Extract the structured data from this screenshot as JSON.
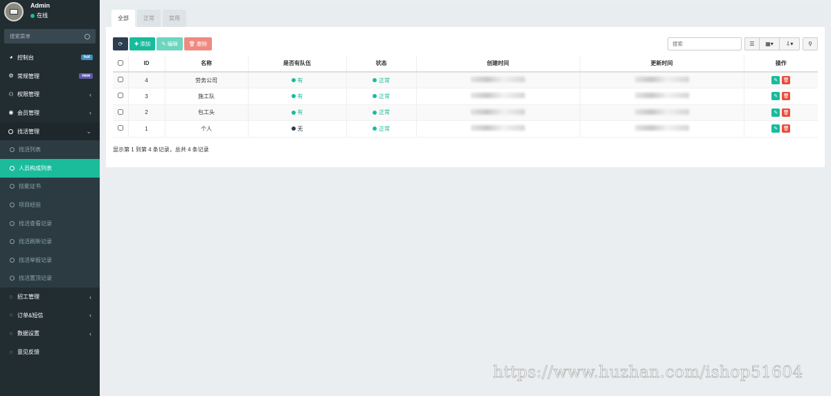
{
  "user": {
    "name": "Admin",
    "status": "在线"
  },
  "sidebar": {
    "search_placeholder": "搜索菜单",
    "items": [
      {
        "label": "控制台",
        "icon": "dashboard-icon",
        "badge": "hot"
      },
      {
        "label": "常规管理",
        "icon": "cogs-icon",
        "badge": "new"
      },
      {
        "label": "权限管理",
        "icon": "group-icon",
        "chevron": "‹"
      },
      {
        "label": "会员管理",
        "icon": "user-circle-icon",
        "chevron": "‹"
      },
      {
        "label": "找活管理",
        "icon": "circle-icon",
        "chevron": "⌄"
      }
    ],
    "sub_items": [
      {
        "label": "找活列表"
      },
      {
        "label": "人员构成列表"
      },
      {
        "label": "技能证书"
      },
      {
        "label": "项目经验"
      },
      {
        "label": "找活查看记录"
      },
      {
        "label": "找活刷新记录"
      },
      {
        "label": "找活举报记录"
      },
      {
        "label": "找活置顶记录"
      }
    ],
    "bottom_items": [
      {
        "label": "招工管理",
        "chevron": "‹"
      },
      {
        "label": "订单&短信",
        "chevron": "‹"
      },
      {
        "label": "数据设置",
        "chevron": "‹"
      },
      {
        "label": "意见反馈"
      }
    ]
  },
  "tabs": [
    {
      "label": "全部"
    },
    {
      "label": "正常"
    },
    {
      "label": "禁用"
    }
  ],
  "toolbar": {
    "add": "添加",
    "edit": "编辑",
    "delete": "删除",
    "search_placeholder": "搜索"
  },
  "table": {
    "headers": {
      "id": "ID",
      "name": "名称",
      "team": "是否有队伍",
      "status": "状态",
      "created": "创建时间",
      "updated": "更新时间",
      "ops": "操作"
    },
    "rows": [
      {
        "id": "4",
        "name": "劳务公司",
        "team": "有",
        "status": "正常"
      },
      {
        "id": "3",
        "name": "施工队",
        "team": "有",
        "status": "正常"
      },
      {
        "id": "2",
        "name": "包工头",
        "team": "有",
        "status": "正常"
      },
      {
        "id": "1",
        "name": "个人",
        "team": "无",
        "status": "正常"
      }
    ]
  },
  "pagination": {
    "info": "显示第 1 到第 4 条记录，总共 4 条记录"
  },
  "watermark": "https://www.huzhan.com/ishop51604",
  "colors": {
    "sidebar": "#222d32",
    "accent": "#18bc9c",
    "danger": "#e74c3c",
    "dark_button": "#2c3e50"
  }
}
